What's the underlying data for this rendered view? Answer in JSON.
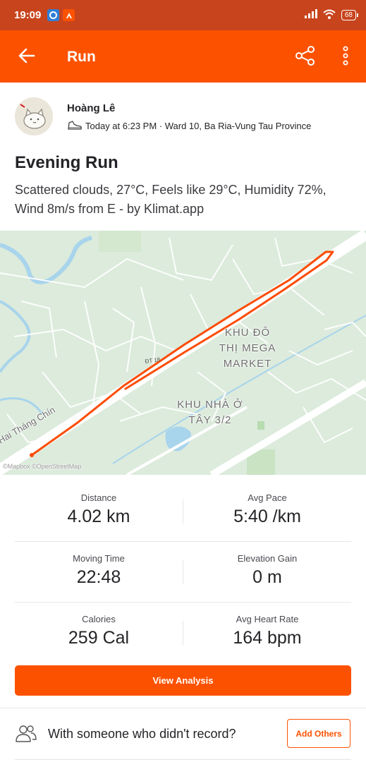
{
  "status_bar": {
    "time": "19:09",
    "battery": "68",
    "colors": {
      "background": "#c8441d"
    },
    "icons": [
      "app-notification-icon",
      "strava-notification-icon",
      "signal-icon",
      "wifi-icon",
      "battery-icon"
    ]
  },
  "app_bar": {
    "title": "Run",
    "colors": {
      "background": "#fc5200"
    },
    "icons": [
      "back-arrow-icon",
      "share-icon",
      "more-vertical-icon"
    ]
  },
  "athlete": {
    "name": "Hoàng Lê",
    "meta": "Today at 6:23 PM · Ward 10, Ba Ria-Vung Tau Province"
  },
  "activity": {
    "title": "Evening Run",
    "description": "Scattered clouds, 27°C, Feels like 29°C, Humidity 72%, Wind 8m/s from E - by Klimat.app"
  },
  "map": {
    "labels": {
      "district_1": "KHU ĐÔ\nTHỊ MEGA\nMARKET",
      "district_2": "KHU NHÀ Ở\nTÂY 3/2",
      "road": "Hai Tháng Chín",
      "attribution": "©Mapbox ©OpenStreetMap"
    },
    "route_color": "#fc4c02"
  },
  "stats": [
    {
      "label": "Distance",
      "value": "4.02 km"
    },
    {
      "label": "Avg Pace",
      "value": "5:40 /km"
    },
    {
      "label": "Moving Time",
      "value": "22:48"
    },
    {
      "label": "Elevation Gain",
      "value": "0 m"
    },
    {
      "label": "Calories",
      "value": "259 Cal"
    },
    {
      "label": "Avg Heart Rate",
      "value": "164 bpm"
    }
  ],
  "actions": {
    "view_analysis": "View Analysis",
    "others_prompt": "With someone who didn't record?",
    "add_others": "Add Others"
  }
}
